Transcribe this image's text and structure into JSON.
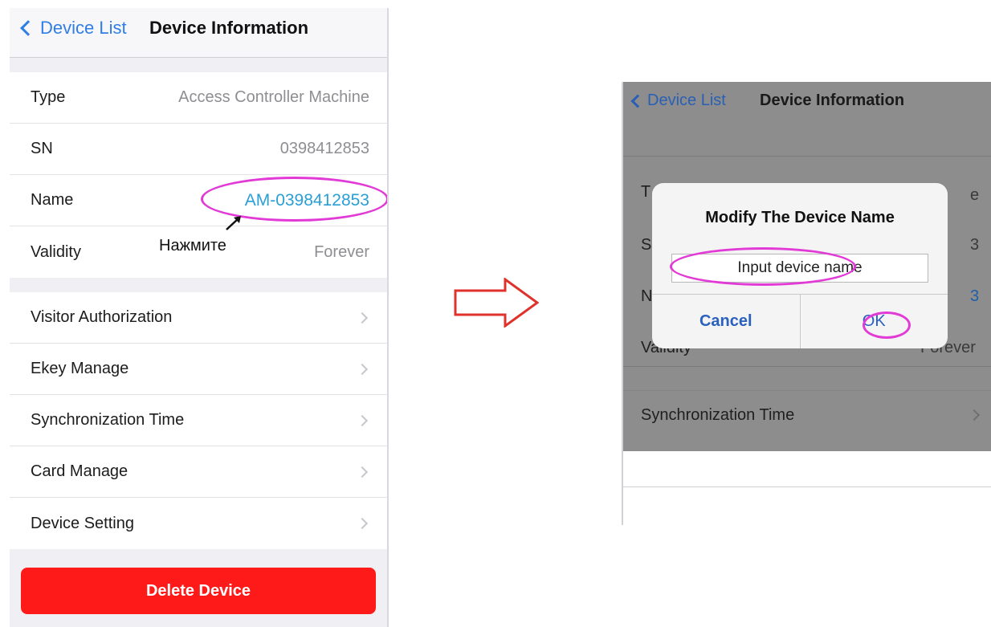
{
  "left": {
    "nav": {
      "back_label": "Device List",
      "title": "Device Information"
    },
    "info_rows": [
      {
        "label": "Type",
        "value": "Access Controller Machine"
      },
      {
        "label": "SN",
        "value": "0398412853"
      },
      {
        "label": "Name",
        "value": "AM-0398412853"
      },
      {
        "label": "Validity",
        "value": "Forever"
      }
    ],
    "menu_rows": [
      {
        "label": "Visitor Authorization"
      },
      {
        "label": "Ekey Manage"
      },
      {
        "label": "Synchronization Time"
      },
      {
        "label": "Card Manage"
      },
      {
        "label": "Device Setting"
      }
    ],
    "delete_label": "Delete Device",
    "hint_text": "Нажмите"
  },
  "right": {
    "nav": {
      "back_label": "Device List",
      "title": "Device Information"
    },
    "background_rows": {
      "type_fragment": "T",
      "type_value_fragment": "e",
      "sn_fragment": "S",
      "sn_value_fragment": "3",
      "name_fragment": "N",
      "name_value_fragment": "3",
      "validity_label": "Validity",
      "validity_value": "Forever",
      "sync_label": "Synchronization Time"
    },
    "dialog": {
      "title": "Modify The Device Name",
      "input_placeholder": "Input device name",
      "cancel_label": "Cancel",
      "ok_label": "OK"
    }
  },
  "colors": {
    "accent_blue": "#2f7ee6",
    "name_value_blue": "#2a9fd6",
    "delete_red": "#ff1a1a",
    "annotation_magenta": "#e23ad6",
    "arrow_red": "#e0312b"
  }
}
